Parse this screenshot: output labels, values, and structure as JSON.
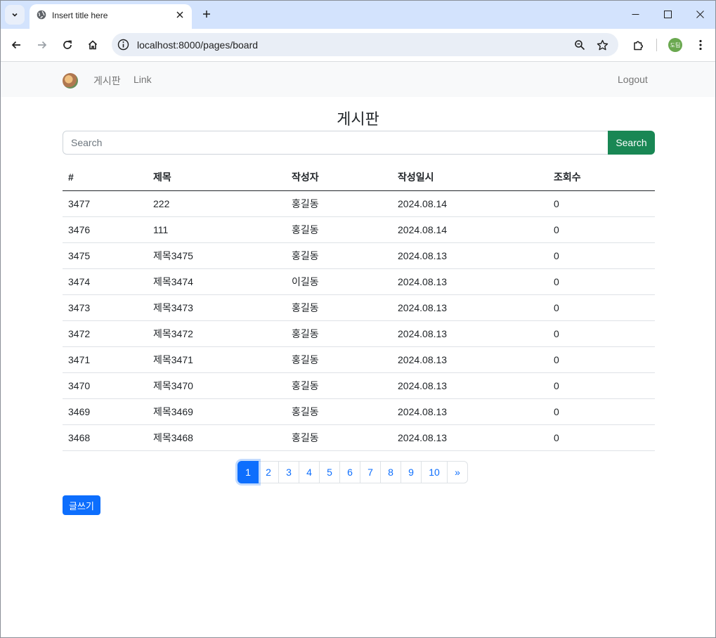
{
  "browser": {
    "tab_title": "Insert title here",
    "url": "localhost:8000/pages/board",
    "profile_initials": "도팀"
  },
  "navbar": {
    "brand_link": "게시판",
    "link": "Link",
    "logout": "Logout"
  },
  "page": {
    "heading": "게시판",
    "search_placeholder": "Search",
    "search_button": "Search",
    "write_button": "글쓰기"
  },
  "table": {
    "headers": [
      "#",
      "제목",
      "작성자",
      "작성일시",
      "조회수"
    ],
    "rows": [
      [
        "3477",
        "222",
        "홍길동",
        "2024.08.14",
        "0"
      ],
      [
        "3476",
        "111",
        "홍길동",
        "2024.08.14",
        "0"
      ],
      [
        "3475",
        "제목3475",
        "홍길동",
        "2024.08.13",
        "0"
      ],
      [
        "3474",
        "제목3474",
        "이길동",
        "2024.08.13",
        "0"
      ],
      [
        "3473",
        "제목3473",
        "홍길동",
        "2024.08.13",
        "0"
      ],
      [
        "3472",
        "제목3472",
        "홍길동",
        "2024.08.13",
        "0"
      ],
      [
        "3471",
        "제목3471",
        "홍길동",
        "2024.08.13",
        "0"
      ],
      [
        "3470",
        "제목3470",
        "홍길동",
        "2024.08.13",
        "0"
      ],
      [
        "3469",
        "제목3469",
        "홍길동",
        "2024.08.13",
        "0"
      ],
      [
        "3468",
        "제목3468",
        "홍길동",
        "2024.08.13",
        "0"
      ]
    ]
  },
  "pagination": {
    "pages": [
      "1",
      "2",
      "3",
      "4",
      "5",
      "6",
      "7",
      "8",
      "9",
      "10"
    ],
    "active": "1",
    "next": "»"
  },
  "colors": {
    "primary": "#0d6efd",
    "success": "#198754",
    "tabstrip": "#d3e3fd"
  }
}
